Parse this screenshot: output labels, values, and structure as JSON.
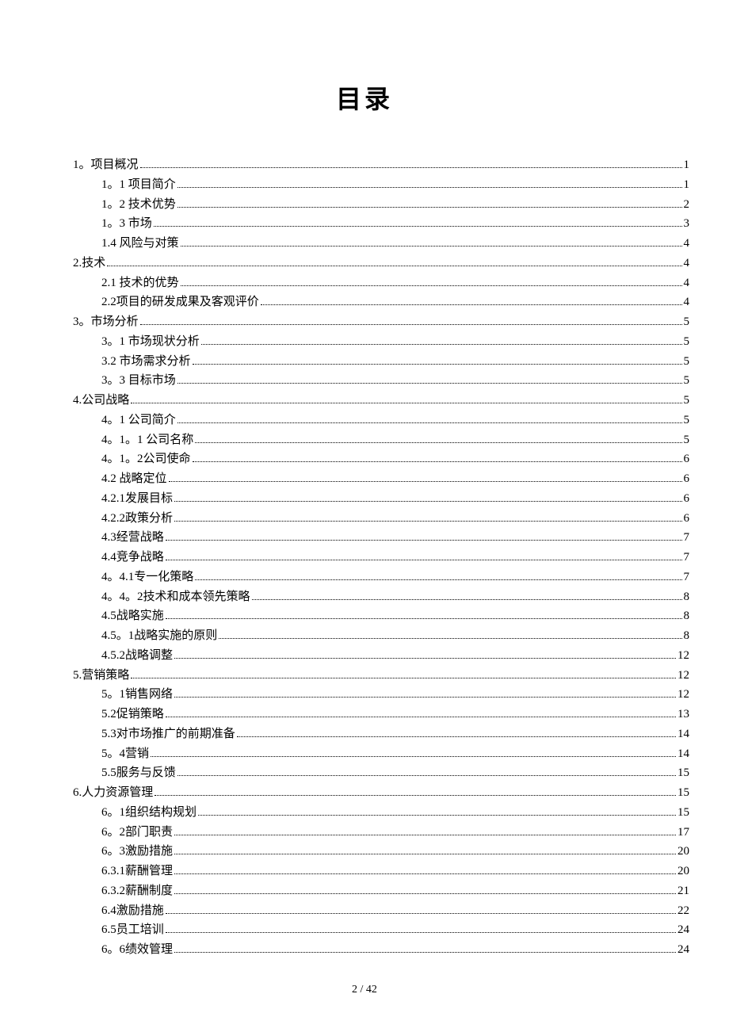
{
  "title": "目录",
  "page_footer": "2 / 42",
  "toc": [
    {
      "level": 1,
      "label": "1。项目概况",
      "page": "1"
    },
    {
      "level": 2,
      "label": "1。1 项目简介",
      "page": "1"
    },
    {
      "level": 2,
      "label": "1。2 技术优势",
      "page": "2"
    },
    {
      "level": 2,
      "label": "1。3 市场",
      "page": "3"
    },
    {
      "level": 2,
      "label": "1.4 风险与对策",
      "page": "4"
    },
    {
      "level": 1,
      "label": "2.技术",
      "page": "4"
    },
    {
      "level": 2,
      "label": "2.1 技术的优势",
      "page": "4"
    },
    {
      "level": 2,
      "label": "2.2项目的研发成果及客观评价",
      "page": "4"
    },
    {
      "level": 1,
      "label": "3。市场分析",
      "page": "5"
    },
    {
      "level": 2,
      "label": "3。1 市场现状分析",
      "page": "5"
    },
    {
      "level": 2,
      "label": "3.2 市场需求分析",
      "page": "5"
    },
    {
      "level": 2,
      "label": "3。3 目标市场",
      "page": "5"
    },
    {
      "level": 1,
      "label": "4.公司战略",
      "page": "5"
    },
    {
      "level": 2,
      "label": "4。1 公司简介",
      "page": "5"
    },
    {
      "level": 2,
      "label": "4。1。1 公司名称",
      "page": "5"
    },
    {
      "level": 2,
      "label": "4。1。2公司使命",
      "page": "6"
    },
    {
      "level": 2,
      "label": "4.2 战略定位 ",
      "page": "6"
    },
    {
      "level": 2,
      "label": "4.2.1发展目标 ",
      "page": "6"
    },
    {
      "level": 2,
      "label": "4.2.2政策分析",
      "page": "6"
    },
    {
      "level": 2,
      "label": "4.3经营战略",
      "page": "7"
    },
    {
      "level": 2,
      "label": "4.4竞争战略",
      "page": "7"
    },
    {
      "level": 2,
      "label": "4。4.1专一化策略",
      "page": "7"
    },
    {
      "level": 2,
      "label": "4。4。2技术和成本领先策略",
      "page": "8"
    },
    {
      "level": 2,
      "label": "4.5战略实施",
      "page": "8"
    },
    {
      "level": 2,
      "label": "4.5。1战略实施的原则",
      "page": "8"
    },
    {
      "level": 2,
      "label": "4.5.2战略调整",
      "page": "12"
    },
    {
      "level": 1,
      "label": "5.营销策略",
      "page": "12"
    },
    {
      "level": 2,
      "label": "5。1销售网络",
      "page": "12"
    },
    {
      "level": 2,
      "label": "5.2促销策略 ",
      "page": "13"
    },
    {
      "level": 2,
      "label": "5.3对市场推广的前期准备 ",
      "page": "14"
    },
    {
      "level": 2,
      "label": "5。4营销 ",
      "page": "14"
    },
    {
      "level": 2,
      "label": "5.5服务与反馈",
      "page": "15"
    },
    {
      "level": 1,
      "label": "6.人力资源管理",
      "page": "15"
    },
    {
      "level": 2,
      "label": "6。1组织结构规划",
      "page": "15"
    },
    {
      "level": 2,
      "label": "6。2部门职责",
      "page": "17"
    },
    {
      "level": 2,
      "label": "6。3激励措施",
      "page": "20"
    },
    {
      "level": 2,
      "label": "6.3.1薪酬管理",
      "page": "20"
    },
    {
      "level": 2,
      "label": "6.3.2薪酬制度",
      "page": "21"
    },
    {
      "level": 2,
      "label": "6.4激励措施",
      "page": "22"
    },
    {
      "level": 2,
      "label": "6.5员工培训",
      "page": "24"
    },
    {
      "level": 2,
      "label": "6。6绩效管理",
      "page": "24"
    }
  ]
}
